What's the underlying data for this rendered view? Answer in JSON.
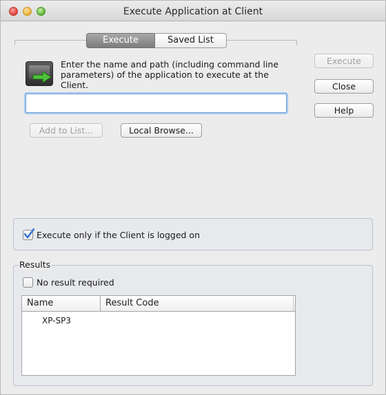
{
  "window": {
    "title": "Execute Application at Client"
  },
  "tabs": [
    {
      "label": "Execute",
      "active": true
    },
    {
      "label": "Saved List",
      "active": false
    }
  ],
  "execute_panel": {
    "instructions": "Enter the name and path (including command line parameters) of the application to execute at the Client.",
    "path_input": {
      "value": "",
      "placeholder": ""
    },
    "add_to_list_label": "Add to List...",
    "local_browse_label": "Local Browse..."
  },
  "side_buttons": {
    "execute_label": "Execute",
    "close_label": "Close",
    "help_label": "Help"
  },
  "logged_on_option": {
    "label": "Execute only if the Client is logged on",
    "checked": true
  },
  "results": {
    "legend": "Results",
    "no_result_label": "No result required",
    "no_result_checked": false,
    "columns": [
      "Name",
      "Result Code"
    ],
    "rows": [
      {
        "name": "XP-SP3",
        "result_code": ""
      }
    ]
  },
  "colors": {
    "accent_focus": "#6fa0d8",
    "checkbox_mark": "#2f6fd0"
  },
  "icons": {
    "app_icon": "execute-application-icon",
    "checkmark": "checkmark-icon"
  }
}
